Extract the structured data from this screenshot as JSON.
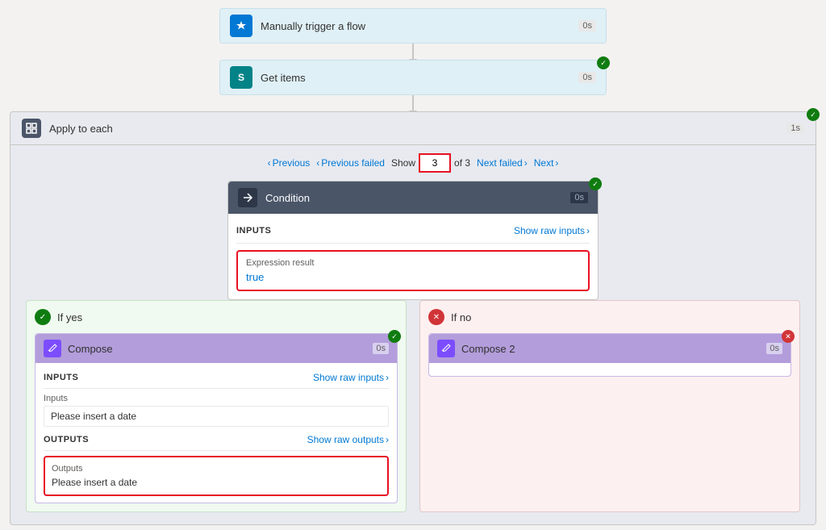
{
  "flow": {
    "cards": [
      {
        "id": "manually-trigger",
        "title": "Manually trigger a flow",
        "icon_type": "blue",
        "icon_letter": "⚡",
        "duration": "0s",
        "has_success": false
      },
      {
        "id": "get-items",
        "title": "Get items",
        "icon_type": "teal",
        "icon_letter": "S",
        "duration": "0s",
        "has_success": true
      }
    ],
    "apply_to_each": {
      "title": "Apply to each",
      "duration": "1s",
      "has_success": true,
      "pagination": {
        "previous_label": "Previous",
        "previous_failed_label": "Previous failed",
        "show_label": "Show",
        "current_page": "3",
        "of_label": "of 3",
        "next_failed_label": "Next failed",
        "next_label": "Next"
      },
      "condition": {
        "title": "Condition",
        "duration": "0s",
        "has_success": true,
        "inputs_label": "INPUTS",
        "show_raw_inputs_label": "Show raw inputs",
        "expression_result_label": "Expression result",
        "expression_result_value": "true"
      }
    },
    "branches": {
      "yes": {
        "title": "If yes",
        "compose": {
          "title": "Compose",
          "duration": "0s",
          "has_success": true,
          "inputs_label": "INPUTS",
          "show_raw_inputs_label": "Show raw inputs",
          "input_field_label": "Inputs",
          "input_field_value": "Please insert a date",
          "outputs_label": "OUTPUTS",
          "show_raw_outputs_label": "Show raw outputs",
          "outputs_field_label": "Outputs",
          "outputs_field_value": "Please insert a date"
        }
      },
      "no": {
        "title": "If no",
        "compose2": {
          "title": "Compose 2",
          "duration": "0s",
          "has_error": true
        }
      }
    }
  }
}
